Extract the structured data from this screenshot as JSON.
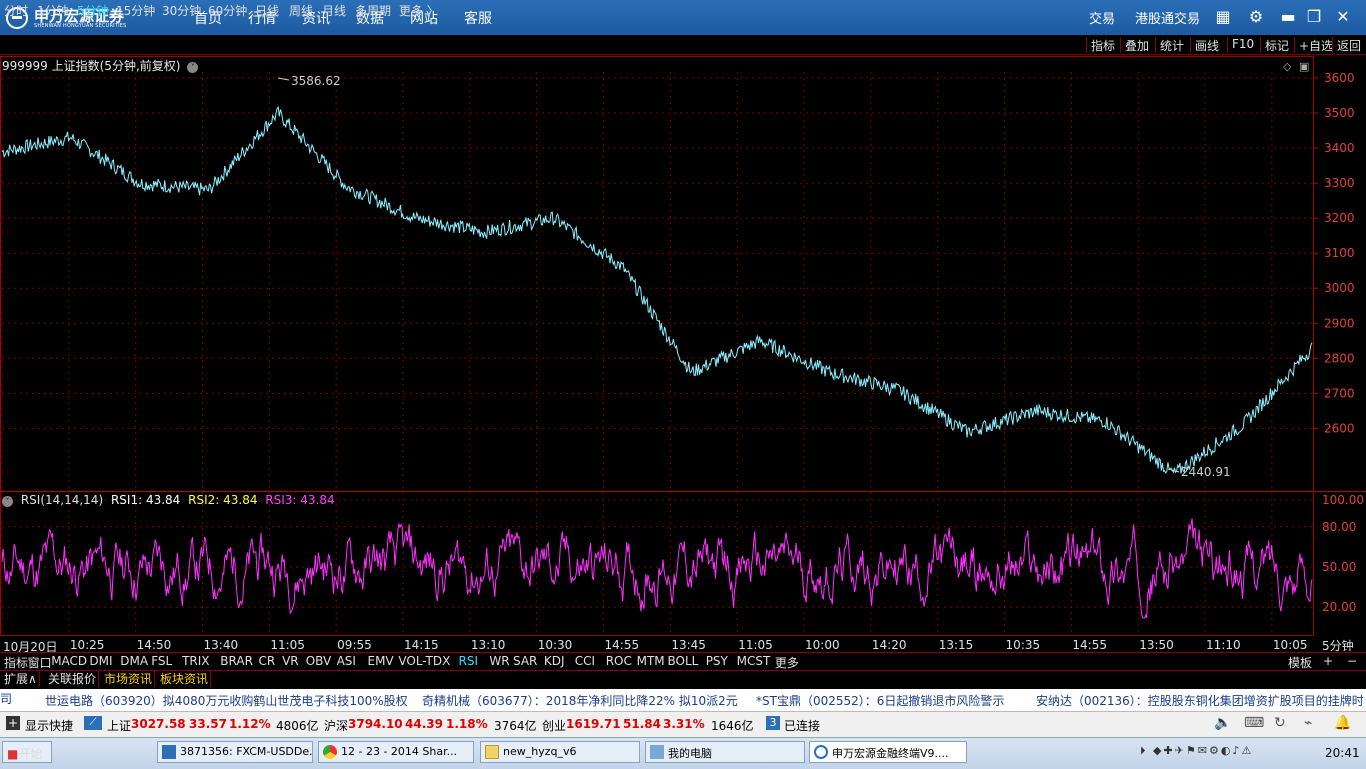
{
  "titlebar": {
    "brand": "申万宏源证券",
    "brand_sub": "SHENWAN HONGYUAN SECURITIES",
    "nav": [
      "首页",
      "行情",
      "资讯",
      "数据",
      "网站",
      "客服"
    ],
    "right": [
      "交易",
      "港股通交易"
    ],
    "icons": [
      "grid-icon",
      "gear-icon",
      "minimize-icon",
      "restore-icon",
      "close-icon"
    ]
  },
  "periods": {
    "items": [
      "分时",
      "1分钟",
      "5分钟",
      "15分钟",
      "30分钟",
      "60分钟",
      "日线",
      "周线",
      "月线",
      "多周期",
      "更多 〉"
    ],
    "active": "5分钟",
    "tools": [
      "指标",
      "叠加",
      "统计",
      "画线",
      "F10",
      "标记",
      "+自选",
      "返回"
    ]
  },
  "chart": {
    "title": "999999 上证指数(5分钟,前复权)",
    "high_label": "3586.62",
    "low_label": "2440.91",
    "price_ticks": [
      "3600",
      "3500",
      "3400",
      "3300",
      "3200",
      "3100",
      "3000",
      "2900",
      "2800",
      "2700",
      "2600"
    ],
    "rsi": {
      "name": "RSI(14,14,14)",
      "rsi1": "RSI1: 43.84",
      "rsi2": "RSI2: 43.84",
      "rsi3": "RSI3: 43.84",
      "ticks": [
        "100.00",
        "80.00",
        "50.00",
        "20.00"
      ]
    },
    "time_labels": [
      "10月20日",
      "10:25",
      "14:50",
      "13:40",
      "11:05",
      "09:55",
      "14:15",
      "13:10",
      "10:30",
      "14:55",
      "13:45",
      "11:05",
      "10:00",
      "14:20",
      "13:15",
      "10:35",
      "14:55",
      "13:50",
      "11:10",
      "10:05"
    ],
    "period_label": "5分钟"
  },
  "chart_data": {
    "type": "line",
    "title": "999999 上证指数(5分钟,前复权)",
    "xlabel": "",
    "ylabel": "",
    "ylim": [
      2400,
      3620
    ],
    "x": [
      "10月20日",
      "10:25",
      "14:50",
      "13:40",
      "11:05",
      "09:55",
      "14:15",
      "13:10",
      "10:30",
      "14:55",
      "13:45",
      "11:05",
      "10:00",
      "14:20",
      "13:15",
      "10:35",
      "14:55",
      "13:50",
      "11:10",
      "10:05"
    ],
    "series": [
      {
        "values": [
          3390,
          3430,
          3300,
          3280,
          3500,
          3290,
          3200,
          3160,
          3200,
          3060,
          2760,
          2850,
          2760,
          2710,
          2590,
          2650,
          2620,
          2470,
          2610,
          2830
        ]
      }
    ],
    "annotations": [
      "3586.62",
      "2440.91"
    ],
    "grid": true,
    "rsi_ylim": [
      0,
      100
    ],
    "rsi_current": 43.84
  },
  "indicators": {
    "items": [
      "指标",
      "窗口",
      "MACD",
      "DMI",
      "DMA",
      "FSL",
      "TRIX",
      "BRAR",
      "CR",
      "VR",
      "OBV",
      "ASI",
      "EMV",
      "VOL-TDX",
      "RSI",
      "WR",
      "SAR",
      "KDJ",
      "CCI",
      "ROC",
      "MTM",
      "BOLL",
      "PSY",
      "MCST",
      "更多"
    ],
    "active": "RSI",
    "right": [
      "模板",
      "+",
      "−"
    ]
  },
  "tabs": {
    "items": [
      "扩展∧",
      "关联报价",
      "市场资讯",
      "板块资讯"
    ],
    "active": [
      "市场资讯",
      "板块资讯"
    ]
  },
  "news": [
    "世运电路（603920）拟4080万元收购鹤山世茂电子科技100%股权",
    "奇精机械（603677）：2018年净利同比降22% 拟10派2元",
    "*ST宝鼎（002552）：6日起撤销退市风险警示",
    "安纳达（002136）：控股股东铜化集团增资扩股项目的挂牌时"
  ],
  "status": {
    "shortcut": "显示快捷",
    "sh_name": "上证",
    "sh_val": "3027.58",
    "sh_chg": "33.57",
    "sh_pct": "1.12%",
    "sh_amt": "4806亿",
    "sz_name": "沪深",
    "sz_val": "3794.10",
    "sz_chg": "44.39",
    "sz_pct": "1.18%",
    "sz_amt": "3764亿",
    "cy_name": "创业",
    "cy_val": "1619.71",
    "cy_chg": "51.84",
    "cy_pct": "3.31%",
    "cy_amt": "1646亿",
    "conn_count": "3",
    "conn": "已连接"
  },
  "taskbar": {
    "start": "开始",
    "tasks": [
      "3871356: FXCM-USDDe...",
      "12 - 23 - 2014 Shar...",
      "new_hyzq_v6",
      "我的电脑",
      "申万宏源金融终端V9...."
    ],
    "clock": "20:41"
  },
  "colors": {
    "price": "#8af0ff",
    "rsi": "#ff30ff",
    "grid": "#8b0000",
    "up": "#ff3030",
    "accent": "#33e0ff"
  }
}
